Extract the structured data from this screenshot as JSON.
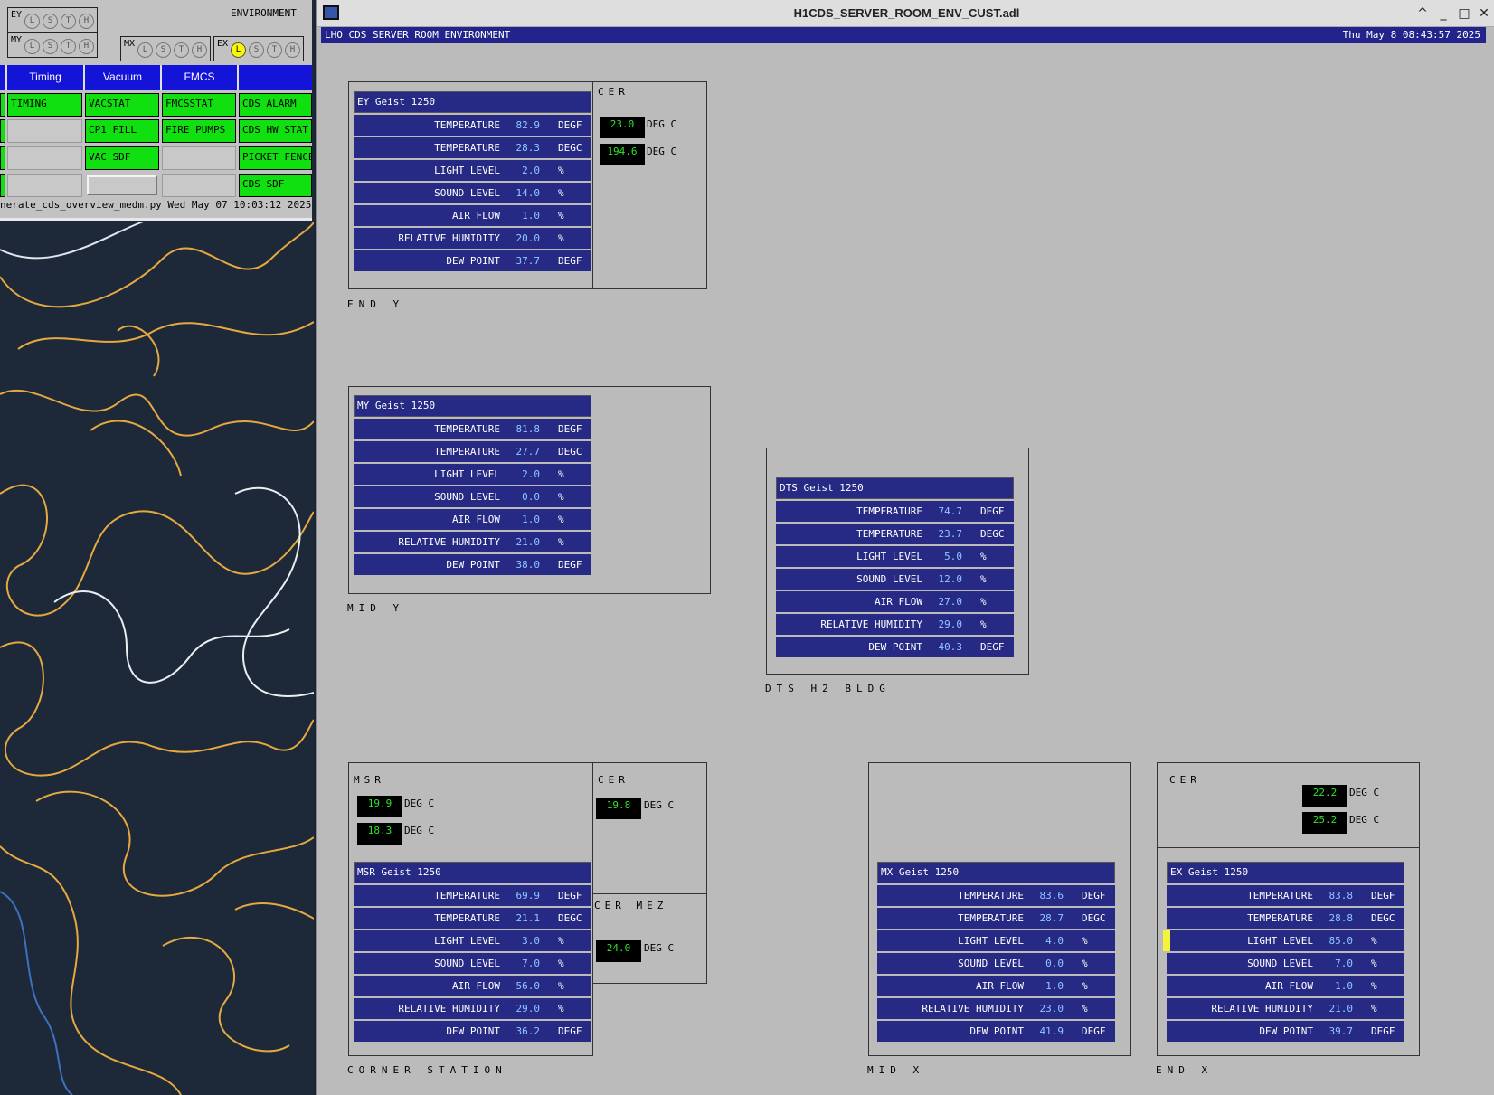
{
  "overview": {
    "env_label": "ENVIRONMENT",
    "status_groups": [
      {
        "name": "EY",
        "leds": [
          "L",
          "S",
          "T",
          "H"
        ],
        "active": []
      },
      {
        "name": "MY",
        "leds": [
          "L",
          "S",
          "T",
          "H"
        ],
        "active": []
      },
      {
        "name": "MX",
        "leds": [
          "L",
          "S",
          "T",
          "H"
        ],
        "active": []
      },
      {
        "name": "EX",
        "leds": [
          "L",
          "S",
          "T",
          "H"
        ],
        "active": [
          "L"
        ]
      }
    ],
    "tabs": [
      "Timing",
      "Vacuum",
      "FMCS",
      ""
    ],
    "buttons": {
      "timing": [
        "TIMING"
      ],
      "vacuum": [
        "VACSTAT",
        "CP1 FILL",
        "VAC SDF"
      ],
      "fmcs": [
        "FMCSSTAT",
        "FIRE PUMPS"
      ],
      "cds": [
        "CDS ALARM",
        "CDS HW STAT",
        "PICKET FENCE",
        "CDS SDF"
      ]
    },
    "footer": "nerate_cds_overview_medm.py Wed May 07 10:03:12 2025"
  },
  "window": {
    "title": "H1CDS_SERVER_ROOM_ENV_CUST.adl",
    "controls": [
      "^",
      "_",
      "□",
      "✕"
    ]
  },
  "banner": {
    "title": "LHO CDS SERVER ROOM ENVIRONMENT",
    "time": "Thu May  8 08:43:57 2025"
  },
  "units": {
    "deg_c": "DEG C"
  },
  "sites": {
    "end_y": {
      "label": "END Y",
      "cer": {
        "label": "CER",
        "values": [
          "23.0",
          "194.6"
        ],
        "unit": "DEG C"
      },
      "geist": {
        "title": "EY Geist 1250",
        "rows": [
          {
            "name": "TEMPERATURE",
            "value": "82.9",
            "unit": "DEGF"
          },
          {
            "name": "TEMPERATURE",
            "value": "28.3",
            "unit": "DEGC"
          },
          {
            "name": "LIGHT LEVEL",
            "value": "2.0",
            "unit": "%"
          },
          {
            "name": "SOUND LEVEL",
            "value": "14.0",
            "unit": "%"
          },
          {
            "name": "AIR FLOW",
            "value": "1.0",
            "unit": "%"
          },
          {
            "name": "RELATIVE HUMIDITY",
            "value": "20.0",
            "unit": "%"
          },
          {
            "name": "DEW POINT",
            "value": "37.7",
            "unit": "DEGF"
          }
        ]
      }
    },
    "mid_y": {
      "label": "MID Y",
      "geist": {
        "title": "MY Geist 1250",
        "rows": [
          {
            "name": "TEMPERATURE",
            "value": "81.8",
            "unit": "DEGF"
          },
          {
            "name": "TEMPERATURE",
            "value": "27.7",
            "unit": "DEGC"
          },
          {
            "name": "LIGHT LEVEL",
            "value": "2.0",
            "unit": "%"
          },
          {
            "name": "SOUND LEVEL",
            "value": "0.0",
            "unit": "%"
          },
          {
            "name": "AIR FLOW",
            "value": "1.0",
            "unit": "%"
          },
          {
            "name": "RELATIVE HUMIDITY",
            "value": "21.0",
            "unit": "%"
          },
          {
            "name": "DEW POINT",
            "value": "38.0",
            "unit": "DEGF"
          }
        ]
      }
    },
    "dts": {
      "label": "DTS H2 BLDG",
      "geist": {
        "title": "DTS Geist 1250",
        "rows": [
          {
            "name": "TEMPERATURE",
            "value": "74.7",
            "unit": "DEGF"
          },
          {
            "name": "TEMPERATURE",
            "value": "23.7",
            "unit": "DEGC"
          },
          {
            "name": "LIGHT LEVEL",
            "value": "5.0",
            "unit": "%"
          },
          {
            "name": "SOUND LEVEL",
            "value": "12.0",
            "unit": "%"
          },
          {
            "name": "AIR FLOW",
            "value": "27.0",
            "unit": "%"
          },
          {
            "name": "RELATIVE HUMIDITY",
            "value": "29.0",
            "unit": "%"
          },
          {
            "name": "DEW POINT",
            "value": "40.3",
            "unit": "DEGF"
          }
        ]
      }
    },
    "corner": {
      "label": "CORNER STATION",
      "msr": {
        "label": "MSR",
        "values": [
          "19.9",
          "18.3"
        ],
        "unit": "DEG C"
      },
      "cer": {
        "label": "CER",
        "values": [
          "19.8"
        ],
        "unit": "DEG C"
      },
      "cer_mez": {
        "label": "CER MEZ",
        "values": [
          "24.0"
        ],
        "unit": "DEG C"
      },
      "geist": {
        "title": "MSR Geist 1250",
        "rows": [
          {
            "name": "TEMPERATURE",
            "value": "69.9",
            "unit": "DEGF"
          },
          {
            "name": "TEMPERATURE",
            "value": "21.1",
            "unit": "DEGC"
          },
          {
            "name": "LIGHT LEVEL",
            "value": "3.0",
            "unit": "%"
          },
          {
            "name": "SOUND LEVEL",
            "value": "7.0",
            "unit": "%"
          },
          {
            "name": "AIR FLOW",
            "value": "56.0",
            "unit": "%"
          },
          {
            "name": "RELATIVE HUMIDITY",
            "value": "29.0",
            "unit": "%"
          },
          {
            "name": "DEW POINT",
            "value": "36.2",
            "unit": "DEGF"
          }
        ]
      }
    },
    "mid_x": {
      "label": "MID X",
      "geist": {
        "title": "MX Geist 1250",
        "rows": [
          {
            "name": "TEMPERATURE",
            "value": "83.6",
            "unit": "DEGF"
          },
          {
            "name": "TEMPERATURE",
            "value": "28.7",
            "unit": "DEGC"
          },
          {
            "name": "LIGHT LEVEL",
            "value": "4.0",
            "unit": "%"
          },
          {
            "name": "SOUND LEVEL",
            "value": "0.0",
            "unit": "%"
          },
          {
            "name": "AIR FLOW",
            "value": "1.0",
            "unit": "%"
          },
          {
            "name": "RELATIVE HUMIDITY",
            "value": "23.0",
            "unit": "%"
          },
          {
            "name": "DEW POINT",
            "value": "41.9",
            "unit": "DEGF"
          }
        ]
      }
    },
    "end_x": {
      "label": "END X",
      "cer": {
        "label": "CER",
        "values": [
          "22.2",
          "25.2"
        ],
        "unit": "DEG C"
      },
      "geist": {
        "title": "EX Geist 1250",
        "rows": [
          {
            "name": "TEMPERATURE",
            "value": "83.8",
            "unit": "DEGF"
          },
          {
            "name": "TEMPERATURE",
            "value": "28.8",
            "unit": "DEGC"
          },
          {
            "name": "LIGHT LEVEL",
            "value": "85.0",
            "unit": "%",
            "alarm": true
          },
          {
            "name": "SOUND LEVEL",
            "value": "7.0",
            "unit": "%"
          },
          {
            "name": "AIR FLOW",
            "value": "1.0",
            "unit": "%"
          },
          {
            "name": "RELATIVE HUMIDITY",
            "value": "21.0",
            "unit": "%"
          },
          {
            "name": "DEW POINT",
            "value": "39.7",
            "unit": "DEGF"
          }
        ]
      }
    }
  }
}
